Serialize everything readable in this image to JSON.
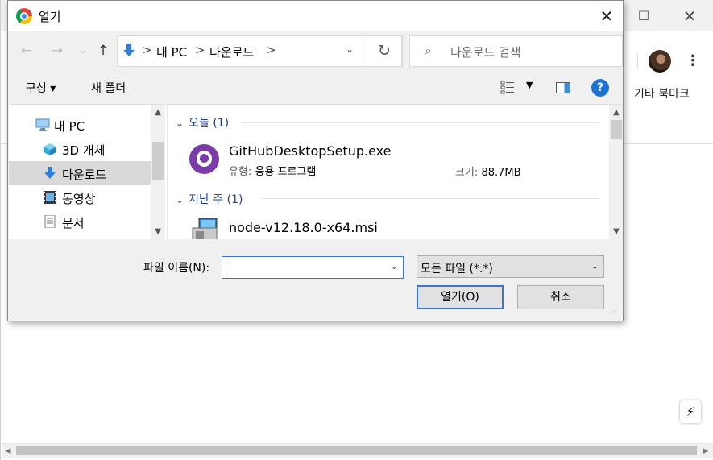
{
  "browser": {
    "bookmarks_label": "기타 북마크",
    "minimize_icon": "minimize-icon",
    "maximize_icon": "maximize-icon",
    "close_icon": "close-icon"
  },
  "dialog": {
    "title": "열기",
    "nav": {
      "back": "←",
      "forward": "→",
      "recent": "⌄",
      "up": "↑"
    },
    "address": {
      "crumbs": [
        "내 PC",
        "다운로드"
      ],
      "separator": ">"
    },
    "search": {
      "placeholder": "다운로드 검색"
    },
    "commands": {
      "organize": "구성 ▾",
      "new_folder": "새 폴더"
    },
    "tree": [
      {
        "label": "내 PC",
        "icon": "pc-icon"
      },
      {
        "label": "3D 개체",
        "icon": "3d-objects-icon"
      },
      {
        "label": "다운로드",
        "icon": "downloads-icon",
        "selected": true
      },
      {
        "label": "동영상",
        "icon": "videos-icon"
      },
      {
        "label": "문서",
        "icon": "documents-icon"
      }
    ],
    "groups": [
      {
        "header": "오늘 (1)",
        "files": [
          {
            "name": "GitHubDesktopSetup.exe",
            "type_label": "유형:",
            "type_value": "응용 프로그램",
            "size_label": "크기:",
            "size_value": "88.7MB",
            "icon": "github-icon"
          }
        ]
      },
      {
        "header": "지난 주 (1)",
        "files": [
          {
            "name": "node-v12.18.0-x64.msi",
            "icon": "msi-installer-icon"
          }
        ]
      }
    ],
    "filename": {
      "label": "파일 이름(N):",
      "value": ""
    },
    "filetype": {
      "selected": "모든 파일 (*.*)"
    },
    "buttons": {
      "open": "열기(O)",
      "cancel": "취소"
    }
  }
}
